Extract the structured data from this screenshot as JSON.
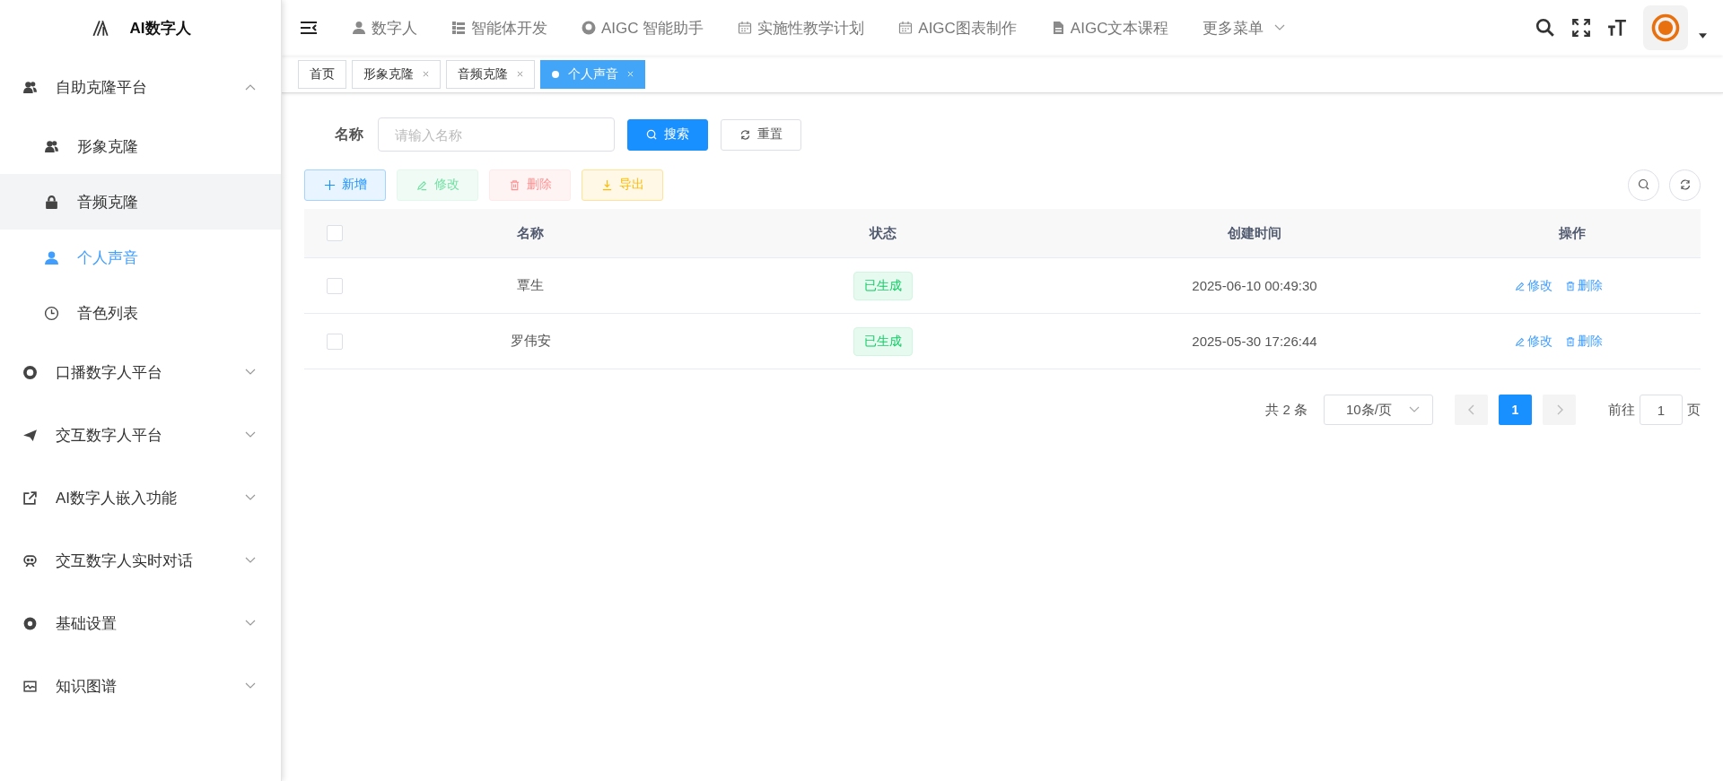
{
  "sidebar": {
    "title": "AI数字人",
    "groups": [
      {
        "label": "自助克隆平台",
        "expanded": true,
        "children": [
          {
            "label": "形象克隆",
            "selected": false,
            "hovered": false
          },
          {
            "label": "音频克隆",
            "selected": false,
            "hovered": true
          },
          {
            "label": "个人声音",
            "selected": true,
            "hovered": false
          },
          {
            "label": "音色列表",
            "selected": false,
            "hovered": false
          }
        ]
      },
      {
        "label": "口播数字人平台",
        "expanded": false
      },
      {
        "label": "交互数字人平台",
        "expanded": false
      },
      {
        "label": "AI数字人嵌入功能",
        "expanded": false
      },
      {
        "label": "交互数字人实时对话",
        "expanded": false
      },
      {
        "label": "基础设置",
        "expanded": false
      },
      {
        "label": "知识图谱",
        "expanded": false
      }
    ]
  },
  "top_nav": [
    {
      "label": "数字人",
      "kind": "link"
    },
    {
      "label": "智能体开发",
      "kind": "link"
    },
    {
      "label": "AIGC 智能助手",
      "kind": "link"
    },
    {
      "label": "实施性教学计划",
      "kind": "link"
    },
    {
      "label": "AIGC图表制作",
      "kind": "link"
    },
    {
      "label": "AIGC文本课程",
      "kind": "link"
    },
    {
      "label": "更多菜单",
      "kind": "dropdown"
    }
  ],
  "tabs": [
    {
      "label": "首页",
      "selected": false,
      "closable": false
    },
    {
      "label": "形象克隆",
      "selected": false,
      "closable": true
    },
    {
      "label": "音频克隆",
      "selected": false,
      "closable": true
    },
    {
      "label": "个人声音",
      "selected": true,
      "closable": true
    }
  ],
  "search": {
    "label": "名称",
    "placeholder": "请输入名称",
    "search_button": "搜索",
    "reset_button": "重置"
  },
  "toolbar": [
    {
      "label": "新增",
      "kind": "add",
      "disabled": false
    },
    {
      "label": "修改",
      "kind": "edit",
      "disabled": true
    },
    {
      "label": "删除",
      "kind": "delete",
      "disabled": true
    },
    {
      "label": "导出",
      "kind": "export",
      "disabled": false
    }
  ],
  "table": {
    "columns": [
      "名称",
      "状态",
      "创建时间",
      "操作"
    ],
    "all_checked": false,
    "rows": [
      {
        "checked": false,
        "name": "覃生",
        "status": "已生成",
        "created": "2025-06-10 00:49:30",
        "actions": [
          "修改",
          "删除"
        ]
      },
      {
        "checked": false,
        "name": "罗伟安",
        "status": "已生成",
        "created": "2025-05-30 17:26:44",
        "actions": [
          "修改",
          "删除"
        ]
      }
    ]
  },
  "pagination": {
    "total": "共 2 条",
    "page_size": "10条/页",
    "pages": [
      {
        "label": "1",
        "selected": true
      }
    ],
    "goto_label": "前往",
    "goto_value": "1",
    "goto_suffix": "页"
  }
}
